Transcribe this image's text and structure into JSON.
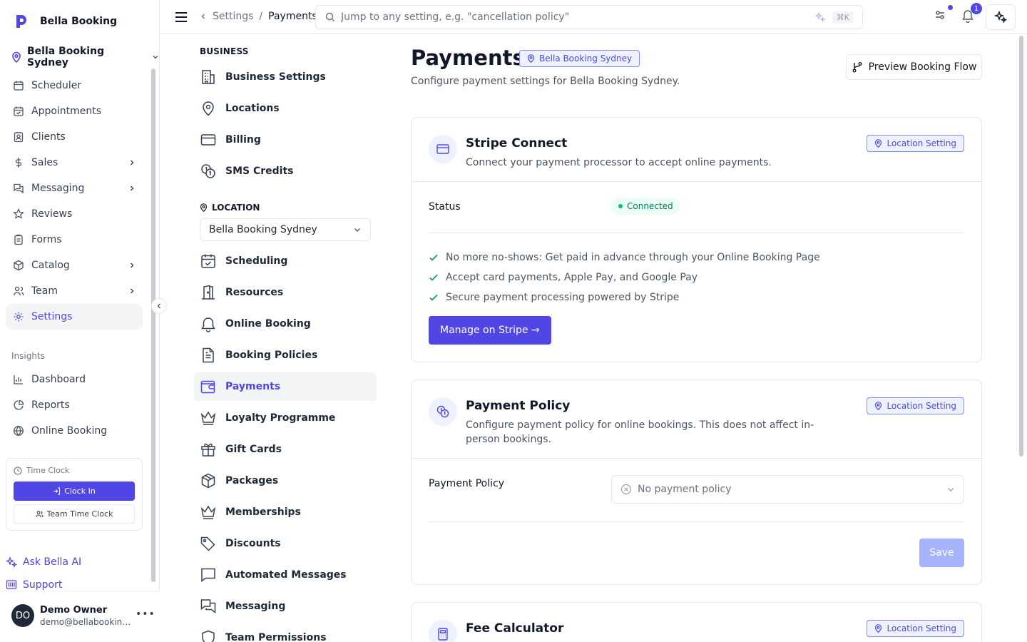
{
  "brand": {
    "name": "Bella Booking"
  },
  "location_switcher": {
    "name": "Bella Booking Sydney"
  },
  "sidebar": {
    "items": [
      {
        "label": "Scheduler"
      },
      {
        "label": "Appointments"
      },
      {
        "label": "Clients"
      },
      {
        "label": "Sales"
      },
      {
        "label": "Messaging"
      },
      {
        "label": "Reviews"
      },
      {
        "label": "Forms"
      },
      {
        "label": "Catalog"
      },
      {
        "label": "Team"
      },
      {
        "label": "Settings"
      }
    ],
    "insights_label": "Insights",
    "insights": [
      {
        "label": "Dashboard"
      },
      {
        "label": "Reports"
      },
      {
        "label": "Online Booking"
      }
    ],
    "time_clock": {
      "title": "Time Clock",
      "clock_in": "Clock In",
      "team": "Team Time Clock"
    },
    "ask_ai": "Ask Bella AI",
    "support": "Support",
    "user": {
      "initials": "DO",
      "name": "Demo Owner",
      "email": "demo@bellabooking..."
    }
  },
  "topbar": {
    "breadcrumb_parent": "Settings",
    "breadcrumb_sep": "/",
    "breadcrumb_current": "Payments",
    "search_placeholder": "Jump to any setting, e.g. \"cancellation policy\"",
    "shortcut": "⌘K",
    "notification_count": "1"
  },
  "settings_nav": {
    "business_label": "BUSINESS",
    "business": [
      {
        "label": "Business Settings"
      },
      {
        "label": "Locations"
      },
      {
        "label": "Billing"
      },
      {
        "label": "SMS Credits"
      }
    ],
    "location_label": "LOCATION",
    "location_select": "Bella Booking Sydney",
    "location": [
      {
        "label": "Scheduling"
      },
      {
        "label": "Resources"
      },
      {
        "label": "Online Booking"
      },
      {
        "label": "Booking Policies"
      },
      {
        "label": "Payments"
      },
      {
        "label": "Loyalty Programme"
      },
      {
        "label": "Gift Cards"
      },
      {
        "label": "Packages"
      },
      {
        "label": "Memberships"
      },
      {
        "label": "Discounts"
      },
      {
        "label": "Automated Messages"
      },
      {
        "label": "Messaging"
      },
      {
        "label": "Team Permissions"
      }
    ]
  },
  "page": {
    "title": "Payments",
    "location_badge": "Bella Booking Sydney",
    "description": "Configure payment settings for Bella Booking Sydney.",
    "preview_button": "Preview Booking Flow"
  },
  "stripe_card": {
    "title": "Stripe Connect",
    "description": "Connect your payment processor to accept online payments.",
    "badge": "Location Setting",
    "status_label": "Status",
    "status_value": "Connected",
    "features": [
      "No more no-shows: Get paid in advance through your Online Booking Page",
      "Accept card payments, Apple Pay, and Google Pay",
      "Secure payment processing powered by Stripe"
    ],
    "button": "Manage on Stripe →"
  },
  "policy_card": {
    "title": "Payment Policy",
    "description": "Configure payment policy for online bookings. This does not affect in-person bookings.",
    "badge": "Location Setting",
    "field_label": "Payment Policy",
    "select_value": "No payment policy",
    "save": "Save"
  },
  "fee_card": {
    "title": "Fee Calculator",
    "badge": "Location Setting"
  },
  "colors": {
    "accent": "#4f46e5",
    "success": "#10b981",
    "badge_bg": "#eef2ff"
  }
}
